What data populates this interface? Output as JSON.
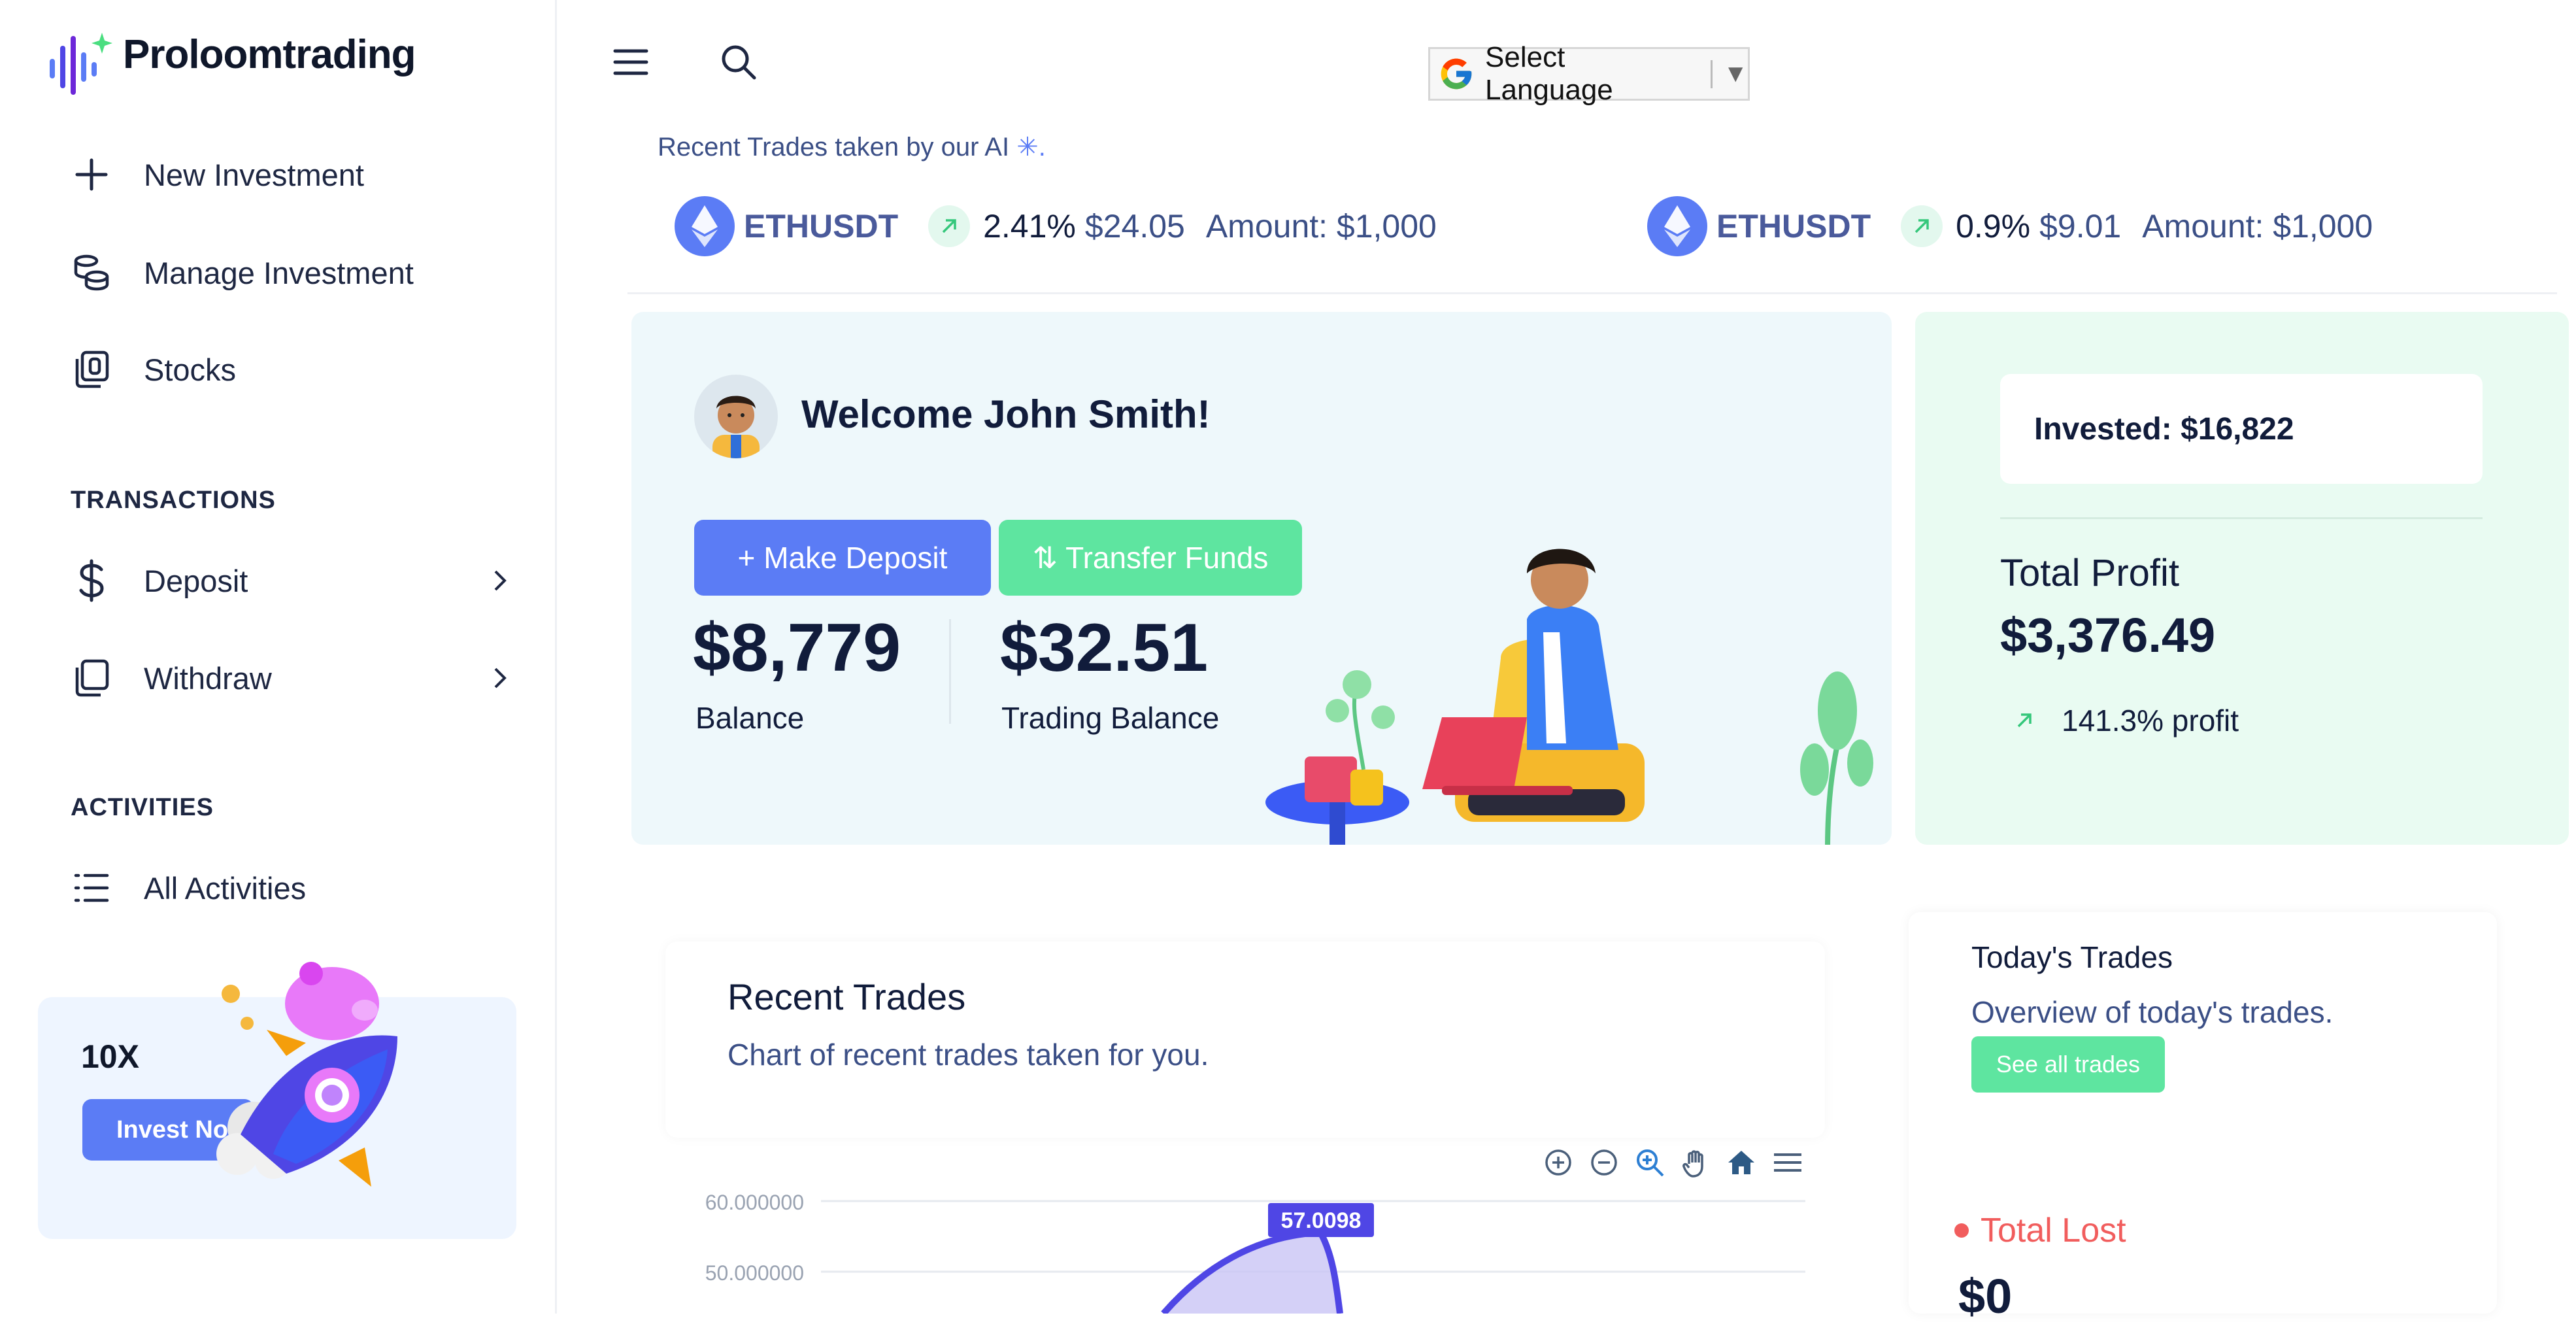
{
  "brand": {
    "name": "Proloomtrading"
  },
  "sidebar": {
    "items": [
      {
        "label": "New Investment",
        "icon": "plus-icon"
      },
      {
        "label": "Manage Investment",
        "icon": "coins-icon"
      },
      {
        "label": "Stocks",
        "icon": "stocks-icon"
      }
    ],
    "transactions_heading": "TRANSACTIONS",
    "transactions": [
      {
        "label": "Deposit",
        "icon": "dollar-icon"
      },
      {
        "label": "Withdraw",
        "icon": "withdraw-icon"
      }
    ],
    "activities_heading": "ACTIVITIES",
    "activities": [
      {
        "label": "All Activities",
        "icon": "list-icon"
      }
    ],
    "promo": {
      "title": "10X",
      "button_label": "Invest Now"
    }
  },
  "topbar": {
    "language_label": "Select Language"
  },
  "ticker": {
    "heading": "Recent Trades taken by our AI",
    "trades": [
      {
        "pair": "ETHUSDT",
        "change": "2.41%",
        "profit": "$24.05",
        "amount": "Amount: $1,000"
      },
      {
        "pair": "ETHUSDT",
        "change": "0.9%",
        "profit": "$9.01",
        "amount": "Amount: $1,000"
      }
    ]
  },
  "welcome": {
    "greeting": "Welcome John Smith!",
    "deposit_label": "+ Make Deposit",
    "transfer_label": "Transfer Funds",
    "balance_value": "$8,779",
    "balance_label": "Balance",
    "trading_value": "$32.51",
    "trading_label": "Trading Balance"
  },
  "profit_card": {
    "invested": "Invested: $16,822",
    "total_profit_label": "Total Profit",
    "total_profit_value": "$3,376.49",
    "profit_pct": "141.3% profit"
  },
  "recent_trades": {
    "title": "Recent Trades",
    "subtitle": "Chart of recent trades taken for you."
  },
  "todays_trades": {
    "title": "Today's Trades",
    "subtitle": "Overview of today's trades.",
    "button_label": "See all trades",
    "total_lost_label": "Total Lost",
    "total_lost_value": "$0"
  },
  "chart_data": {
    "type": "area",
    "y_ticks": [
      "60.000000",
      "50.000000"
    ],
    "peak_label": "57.0098",
    "series": [
      {
        "values": [
          57.0098
        ]
      }
    ],
    "toolbar": [
      "zoom-in-icon",
      "zoom-out-icon",
      "zoom-select-icon",
      "pan-icon",
      "home-icon",
      "menu-icon"
    ]
  },
  "colors": {
    "primary": "#5b7cf5",
    "accent_green": "#5ee5a0",
    "card_blue": "#eef8fb",
    "card_green": "#e9fbf2",
    "loss_red": "#f15d5d"
  }
}
